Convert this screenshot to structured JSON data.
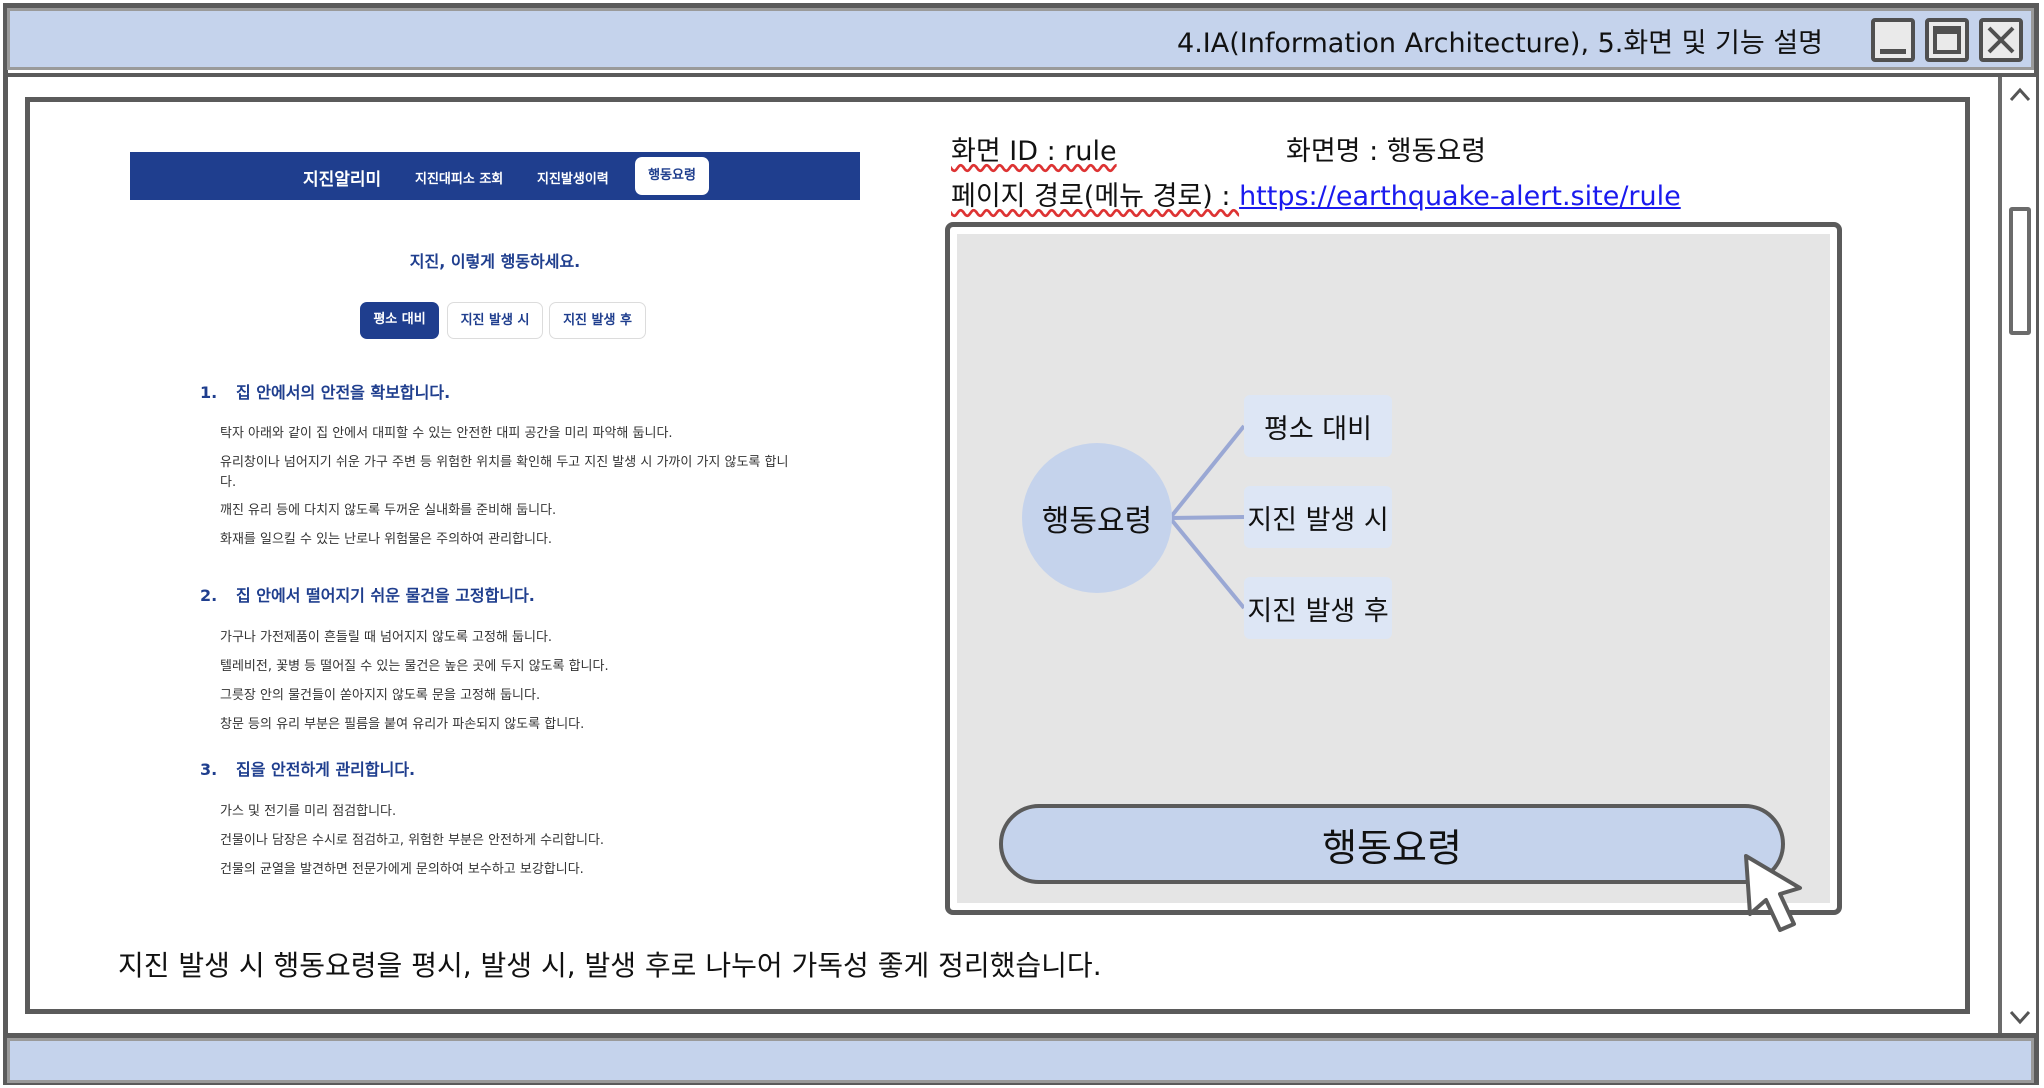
{
  "window": {
    "title": "4.IA(Information Architecture), 5.화면 및 기능 설명",
    "controls": [
      "minimize-icon",
      "maximize-icon",
      "close-icon"
    ]
  },
  "site": {
    "brand": "지진알리미",
    "nav": [
      "지진대피소 조회",
      "지진발생이력",
      "행동요령"
    ],
    "heading": "지진, 이렇게 행동하세요.",
    "tabs": [
      "평소 대비",
      "지진 발생 시",
      "지진 발생 후"
    ],
    "sections": [
      {
        "num": "1.",
        "title": "집 안에서의 안전을 확보합니다.",
        "lines": [
          "탁자 아래와 같이 집 안에서 대피할 수 있는 안전한 대피 공간을 미리 파악해 둡니다.",
          "유리창이나 넘어지기 쉬운 가구 주변 등 위험한 위치를 확인해 두고 지진 발생 시 가까이 가지 않도록 합니",
          "다.",
          "깨진 유리 등에 다치지 않도록 두꺼운 실내화를 준비해 둡니다.",
          "화재를 일으킬 수 있는 난로나 위험물은 주의하여 관리합니다."
        ]
      },
      {
        "num": "2.",
        "title": "집 안에서 떨어지기 쉬운 물건을 고정합니다.",
        "lines": [
          "가구나 가전제품이 흔들릴 때 넘어지지 않도록 고정해 둡니다.",
          "텔레비전, 꽃병 등 떨어질 수 있는 물건은 높은 곳에 두지 않도록 합니다.",
          "그릇장 안의 물건들이 쏟아지지 않도록 문을 고정해 둡니다.",
          "창문 등의 유리 부분은 필름을 붙여 유리가 파손되지 않도록 합니다."
        ]
      },
      {
        "num": "3.",
        "title": "집을 안전하게 관리합니다.",
        "lines": [
          "가스 및 전기를 미리 점검합니다.",
          "건물이나 담장은 수시로 점검하고, 위험한 부분은 안전하게 수리합니다.",
          "건물의 균열을 발견하면 전문가에게 문의하여 보수하고 보강합니다."
        ]
      }
    ]
  },
  "meta": {
    "screen_id_label": "화면 ID : rule",
    "screen_name_label": "화면명 : 행동요령",
    "path_label": "페이지 경로(메뉴 경로) : ",
    "path_url": "https://earthquake-alert.site/rule"
  },
  "diagram": {
    "root": "행동요령",
    "children": [
      "평소 대비",
      "지진 발생 시",
      "지진 발생 후"
    ],
    "button": "행동요령"
  },
  "caption": "지진 발생 시 행동요령을 평시, 발생 시, 발생 후로 나누어 가독성 좋게 정리했습니다."
}
